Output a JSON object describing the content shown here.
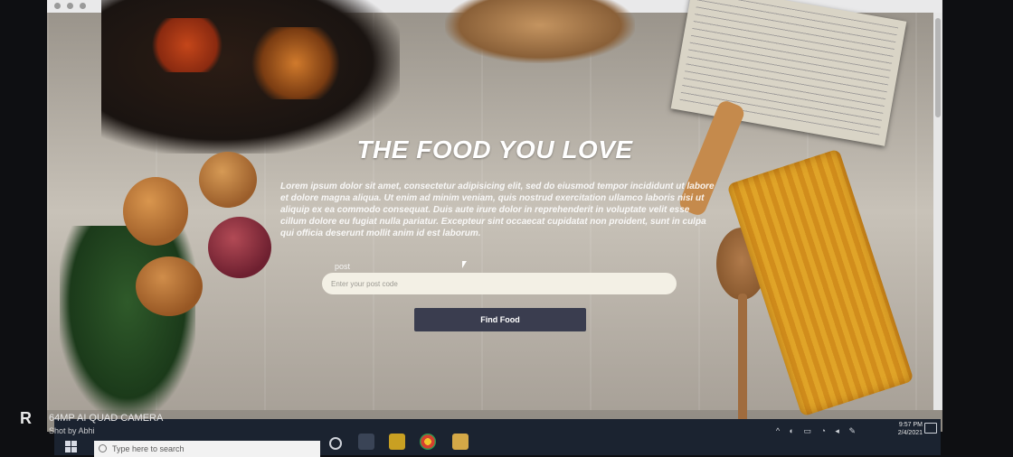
{
  "page": {
    "title": "THE FOOD YOU LOVE",
    "paragraph": "Lorem ipsum dolor sit amet, consectetur adipisicing elit, sed do eiusmod tempor incididunt ut labore et dolore magna aliqua. Ut enim ad minim veniam, quis nostrud exercitation ullamco laboris nisi ut aliquip ex ea commodo consequat. Duis aute irure dolor in reprehenderit in voluptate velit esse cillum dolore eu fugiat nulla pariatur. Excepteur sint occaecat cupidatat non proident, sunt in culpa qui officia deserunt mollit anim id est laborum.",
    "post_label": "post",
    "post_placeholder": "Enter your post code",
    "button_label": "Find Food"
  },
  "taskbar": {
    "search_placeholder": "Type here to search",
    "time": "9:57 PM",
    "date": "2/4/2021"
  },
  "watermark": {
    "logo": "R",
    "line1": "64MP AI QUAD CAMERA",
    "line2": "Shot by Abhi"
  },
  "colors": {
    "button_bg": "#3a3d4f",
    "input_bg": "#f3f0e5",
    "taskbar_bg": "#1b2330"
  }
}
